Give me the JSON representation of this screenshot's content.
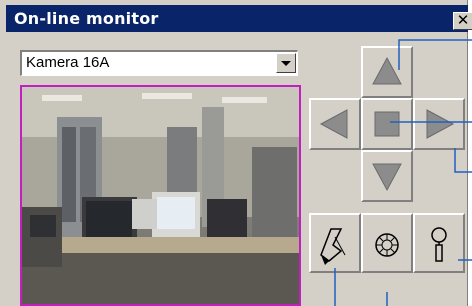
{
  "window": {
    "title": "On-line monitor",
    "close_glyph": "✕"
  },
  "camera_select": {
    "value": "Kamera 16A"
  },
  "ptz": {
    "buttons": [
      {
        "name": "tilt-up",
        "icon": "arrow-up-icon"
      },
      {
        "name": "pan-left",
        "icon": "arrow-left-icon"
      },
      {
        "name": "home",
        "icon": "square-stop-icon"
      },
      {
        "name": "pan-right",
        "icon": "arrow-right-icon"
      },
      {
        "name": "tilt-down",
        "icon": "arrow-down-icon"
      },
      {
        "name": "focus",
        "icon": "focus-icon"
      },
      {
        "name": "iris",
        "icon": "iris-icon"
      },
      {
        "name": "zoom",
        "icon": "zoom-icon"
      }
    ]
  },
  "colors": {
    "title_bar": "#0a246a",
    "face": "#d4d0c8",
    "video_border": "#c020c0",
    "callout_lines": "#2060c0"
  }
}
